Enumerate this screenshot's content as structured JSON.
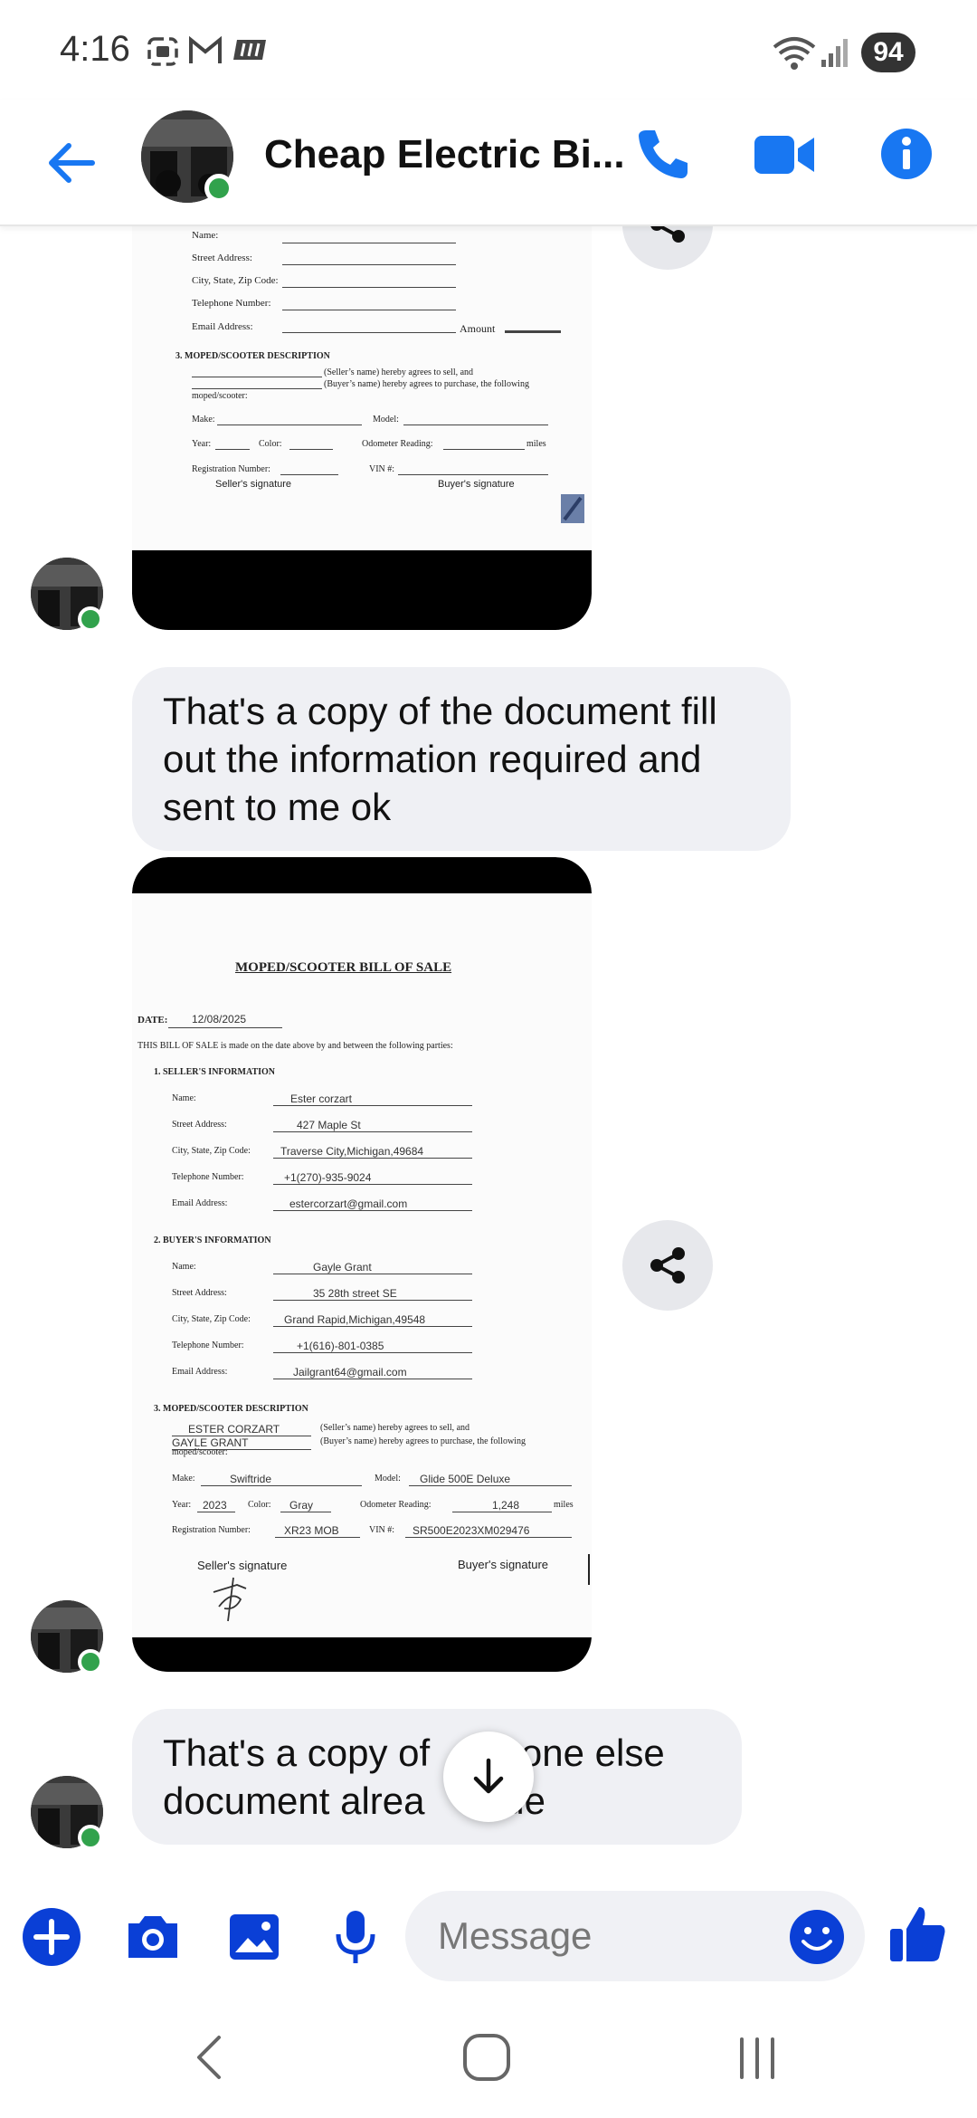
{
  "status": {
    "time": "4:16",
    "battery": "94"
  },
  "header": {
    "contact_name": "Cheap Electric Bi...",
    "icons": [
      "back-arrow-icon",
      "phone-icon",
      "video-camera-icon",
      "info-icon"
    ]
  },
  "colors": {
    "accent": "#1877f2",
    "composer_blue": "#0a3fd6",
    "online": "#31a24c",
    "bubble": "#eff0f4"
  },
  "doc1": {
    "fields": [
      "Name:",
      "Street Address:",
      "City, State, Zip Code:",
      "Telephone Number:",
      "Email Address:"
    ],
    "amount_label": "Amount",
    "section3_title": "3.  MOPED/SCOOTER DESCRIPTION",
    "seller_clause": "(Seller’s name) hereby agrees to sell, and",
    "buyer_clause": "(Buyer’s name) hereby agrees to purchase, the following",
    "moped_line": "moped/scooter:",
    "make_label": "Make:",
    "model_label": "Model:",
    "year_label": "Year:",
    "color_label": "Color:",
    "odometer_label": "Odometer Reading:",
    "miles_label": "miles",
    "reg_label": "Registration Number:",
    "vin_label": "VIN #:",
    "seller_sig": "Seller's signature",
    "buyer_sig": "Buyer's signature"
  },
  "messages": {
    "msg1": "That's a copy of the document fill out the information required and sent to me ok",
    "msg2_line1": "That's a copy of",
    "msg2_line1b": "neone else",
    "msg2_line2": "document alrea",
    "msg2_line2b": "nade"
  },
  "doc2": {
    "title": "MOPED/SCOOTER BILL OF SALE",
    "date_label": "DATE:",
    "date_value": "12/08/2025",
    "intro": "THIS BILL OF SALE is made on the date above by and between the following parties:",
    "seller_section": "1.  SELLER'S INFORMATION",
    "buyer_section": "2.  BUYER'S INFORMATION",
    "moped_section": "3.  MOPED/SCOOTER DESCRIPTION",
    "labels": {
      "name": "Name:",
      "street": "Street Address:",
      "city": "City, State, Zip Code:",
      "phone": "Telephone Number:",
      "email": "Email Address:"
    },
    "seller": {
      "name": "Ester corzart",
      "street": "427 Maple St",
      "city": "Traverse City,Michigan,49684",
      "phone": "+1(270)-935-9024",
      "email": "estercorzart@gmail.com"
    },
    "buyer": {
      "name": "Gayle Grant",
      "street": "35 28th street SE",
      "city": "Grand Rapid,Michigan,49548",
      "phone": "+1(616)-801-0385",
      "email": "Jailgrant64@gmail.com"
    },
    "seller_name_caps": "ESTER CORZART",
    "buyer_name_caps": "GAYLE GRANT",
    "seller_clause": "(Seller’s name) hereby agrees to sell, and",
    "buyer_clause": "(Buyer’s name) hereby agrees to purchase, the following",
    "moped_line": "moped/scooter:",
    "make_label": "Make:",
    "make_value": "Swiftride",
    "model_label": "Model:",
    "model_value": "Glide 500E Deluxe",
    "year_label": "Year:",
    "year_value": "2023",
    "color_label": "Color:",
    "color_value": "Gray",
    "odometer_label": "Odometer Reading:",
    "odometer_value": "1,248",
    "miles_label": "miles",
    "reg_label": "Registration Number:",
    "reg_value": "XR23 MOB",
    "vin_label": "VIN #:",
    "vin_value": "SR500E2023XM029476",
    "seller_sig": "Seller's signature",
    "buyer_sig": "Buyer's signature"
  },
  "composer": {
    "placeholder": "Message",
    "icons": [
      "plus-icon",
      "camera-icon",
      "gallery-icon",
      "microphone-icon",
      "emoji-icon",
      "thumbs-up-icon"
    ]
  },
  "navbar": {
    "icons": [
      "nav-back-icon",
      "nav-home-icon",
      "nav-recents-icon"
    ]
  }
}
